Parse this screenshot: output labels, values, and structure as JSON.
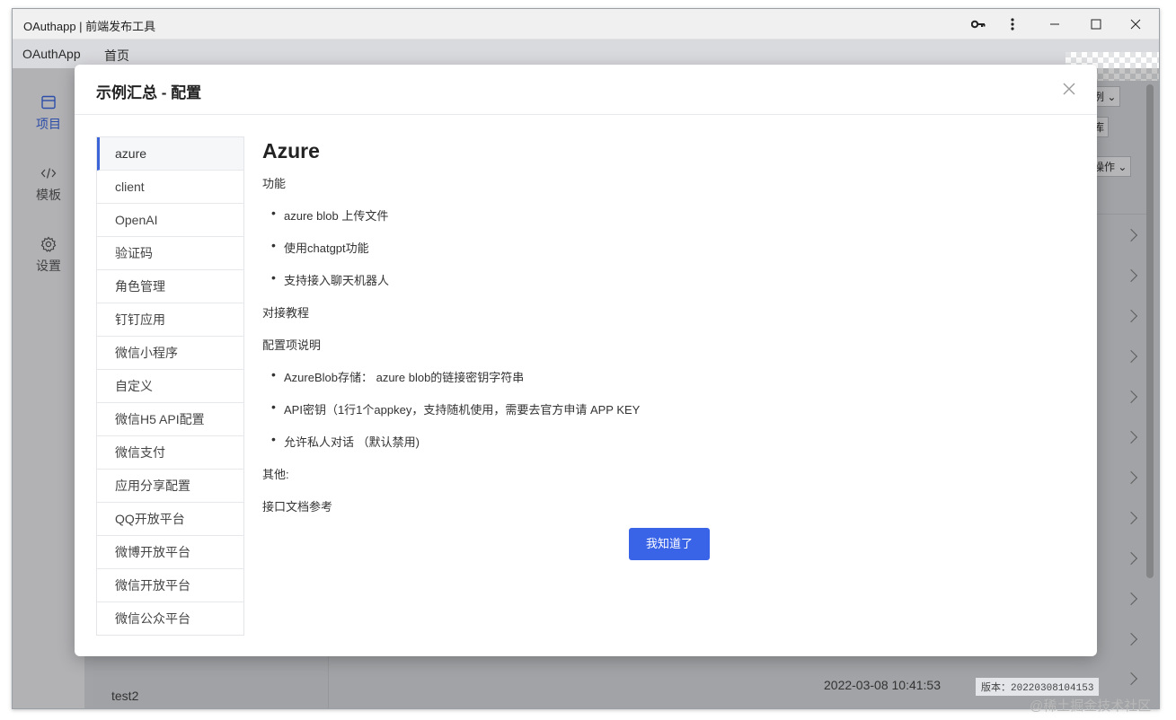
{
  "window": {
    "title": "OAuthapp | 前端发布工具"
  },
  "menubar": {
    "app_name": "OAuthApp",
    "home": "首页"
  },
  "sidebar": {
    "items": [
      {
        "label": "项目",
        "icon": "calendar-icon",
        "active": true
      },
      {
        "label": "模板",
        "icon": "code-icon",
        "active": false
      },
      {
        "label": "设置",
        "icon": "gear-icon",
        "active": false
      }
    ]
  },
  "background": {
    "list_item": "test2",
    "date": "2022-03-08 10:41:53",
    "version": "版本：20220308104153",
    "peek_1": "例 ⌄",
    "peek_2": "库",
    "peek_3": "操作 ⌄"
  },
  "dialog": {
    "title": "示例汇总 - 配置",
    "menu": [
      "azure",
      "client",
      "OpenAI",
      "验证码",
      "角色管理",
      "钉钉应用",
      "微信小程序",
      "自定义",
      "微信H5 API配置",
      "微信支付",
      "应用分享配置",
      "QQ开放平台",
      "微博开放平台",
      "微信开放平台",
      "微信公众平台"
    ],
    "heading": "Azure",
    "features_label": "功能",
    "features": [
      "azure blob 上传文件",
      "使用chatgpt功能",
      "支持接入聊天机器人"
    ],
    "tutorial_link": "对接教程",
    "config_label": "配置项说明",
    "config_items": [
      "AzureBlob存储： azure blob的链接密钥字符串",
      "API密钥（1行1个appkey，支持随机使用，需要去官方申请 APP KEY",
      "允许私人对话 （默认禁用)"
    ],
    "other_label": "其他:",
    "api_doc_link": "接口文档参考",
    "confirm_button": "我知道了"
  },
  "watermark": "@稀土掘金技术社区",
  "colors": {
    "accent": "#3a64e8",
    "link": "#2a6fc4"
  }
}
